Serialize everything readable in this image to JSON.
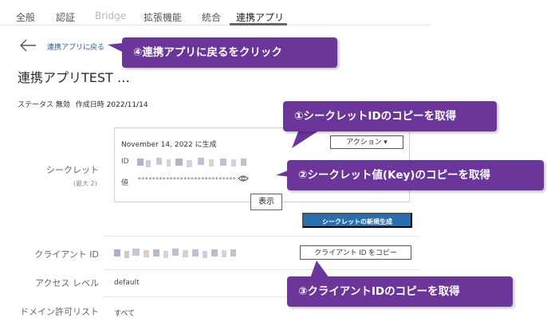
{
  "tabs": [
    {
      "label": "全般",
      "state": "normal"
    },
    {
      "label": "認証",
      "state": "normal"
    },
    {
      "label": "Bridge",
      "state": "disabled"
    },
    {
      "label": "拡張機能",
      "state": "normal"
    },
    {
      "label": "統合",
      "state": "normal"
    },
    {
      "label": "連携アプリ",
      "state": "active"
    }
  ],
  "back": {
    "label": "連携アプリに戻る",
    "icon": "arrow-left-icon"
  },
  "page_title": "連携アプリTEST …",
  "meta": {
    "status_label": "ステータス",
    "status_value": "無効",
    "created_label": "作成日時",
    "created_value": "2022/11/14"
  },
  "secret": {
    "label": "シークレット",
    "sublabel": "(最大 2)",
    "created_text": "November 14, 2022 に生成",
    "action_button": "アクション ▾",
    "id_label": "ID",
    "value_label": "値",
    "masked_value": "****************************",
    "tooltip": "表示",
    "new_secret_button": "シークレットの新規生成"
  },
  "client": {
    "label": "クライアント ID",
    "copy_button": "クライアント ID をコピー"
  },
  "access": {
    "label": "アクセス レベル",
    "value": "default"
  },
  "domain": {
    "label": "ドメイン許可リスト",
    "value": "すべて"
  },
  "callouts": {
    "c1": "④連携アプリに戻るをクリック",
    "c2": "①シークレットIDのコピーを取得",
    "c3": "②シークレット値(Key)のコピーを取得",
    "c4": "③クライアントIDのコピーを取得"
  },
  "colors": {
    "callout": "#6b359a",
    "primary_button": "#2a6fad",
    "link": "#2f5f97"
  }
}
